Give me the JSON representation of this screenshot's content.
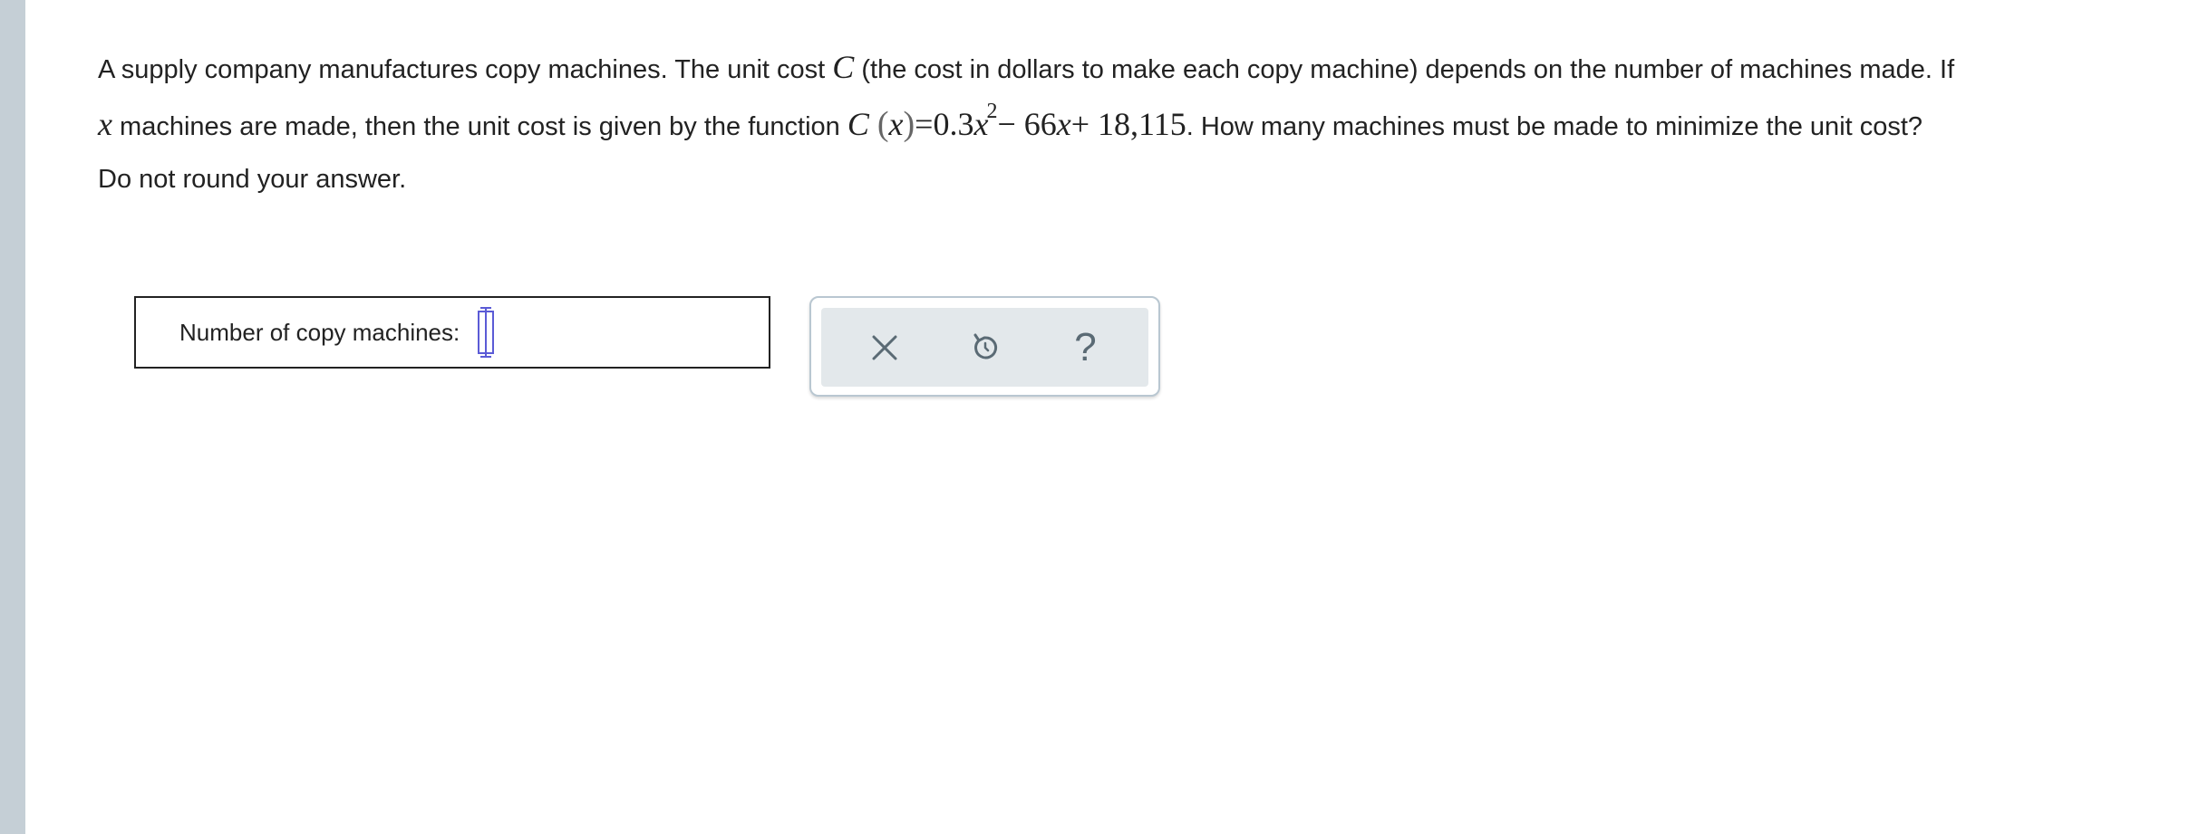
{
  "question": {
    "line1_a": "A supply company manufactures copy machines. The unit cost ",
    "line1_var": "C",
    "line1_b": " (the cost in dollars to make each copy machine) depends on the number of machines made. If",
    "line2_var": "x",
    "line2_a": " machines are made, then the unit cost is given by the function ",
    "fn_name": "C",
    "fn_arg": "x",
    "fn_eq": "=0.3",
    "fn_x1": "x",
    "fn_exp": "2",
    "fn_mid": "− 66",
    "fn_x2": "x",
    "fn_end": "+ 18,115",
    "line2_b": ". How many machines must be made to minimize the unit cost?",
    "instruction": "Do not round your answer."
  },
  "answer": {
    "label": "Number of copy machines:",
    "value": ""
  },
  "tools": {
    "clear_icon": "close-icon",
    "undo_icon": "undo-icon",
    "help_icon": "help-icon",
    "help_glyph": "?"
  },
  "colors": {
    "left_rail": "#c5cfd6",
    "cursor": "#5b5bd6",
    "tool_icon": "#5a6a74",
    "tool_panel": "#e3e8eb",
    "tool_border": "#b9c7d1"
  }
}
